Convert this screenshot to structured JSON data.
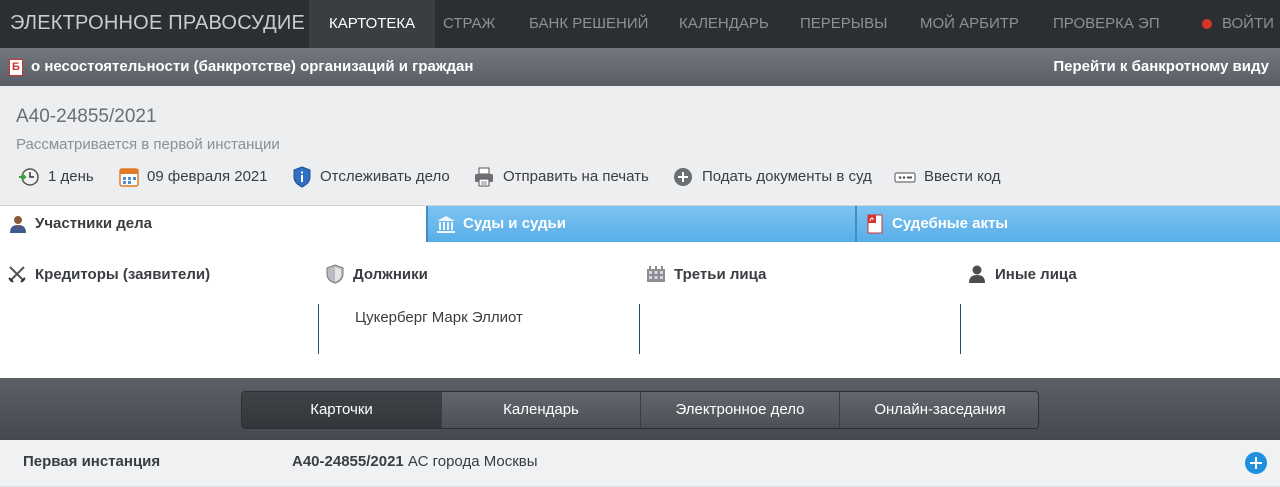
{
  "topnav": {
    "brand": "ЭЛЕКТРОННОЕ ПРАВОСУДИЕ",
    "items": [
      "КАРТОТЕКА",
      "СТРАЖ",
      "БАНК РЕШЕНИЙ",
      "КАЛЕНДАРЬ",
      "ПЕРЕРЫВЫ",
      "МОЙ АРБИТР",
      "ПРОВЕРКА ЭП"
    ],
    "active_item": "КАРТОТЕКА",
    "login": "ВОЙТИ"
  },
  "category": {
    "badge": "Б",
    "title": "о несостоятельности (банкротстве) организаций и граждан",
    "link": "Перейти к банкротному виду"
  },
  "case": {
    "number": "А40-24855/2021",
    "status": "Рассматривается в первой инстанции",
    "tools": {
      "duration": "1 день",
      "date": "09 февраля 2021",
      "track": "Отслеживать дело",
      "print": "Отправить на печать",
      "submit": "Подать документы в суд",
      "code": "Ввести код"
    }
  },
  "tabs": {
    "participants": "Участники дела",
    "courts": "Суды и судьи",
    "acts": "Судебные акты"
  },
  "participants": {
    "creditors": {
      "title": "Кредиторы (заявители)",
      "entries": []
    },
    "debtors": {
      "title": "Должники",
      "entries": [
        "Цукерберг Марк Эллиот"
      ]
    },
    "third": {
      "title": "Третьи лица",
      "entries": []
    },
    "other": {
      "title": "Иные лица",
      "entries": []
    }
  },
  "bottom_tabs": {
    "cards": "Карточки",
    "calendar": "Календарь",
    "edelo": "Электронное дело",
    "online": "Онлайн-заседания"
  },
  "instance": {
    "label": "Первая инстанция",
    "number": "А40-24855/2021",
    "court": " АС города Москвы"
  },
  "colors": {
    "nav_bg": "#2b2e32",
    "tab_blue": "#59aee8",
    "add_button": "#1f8fe0",
    "login_dot": "#d9342b"
  }
}
